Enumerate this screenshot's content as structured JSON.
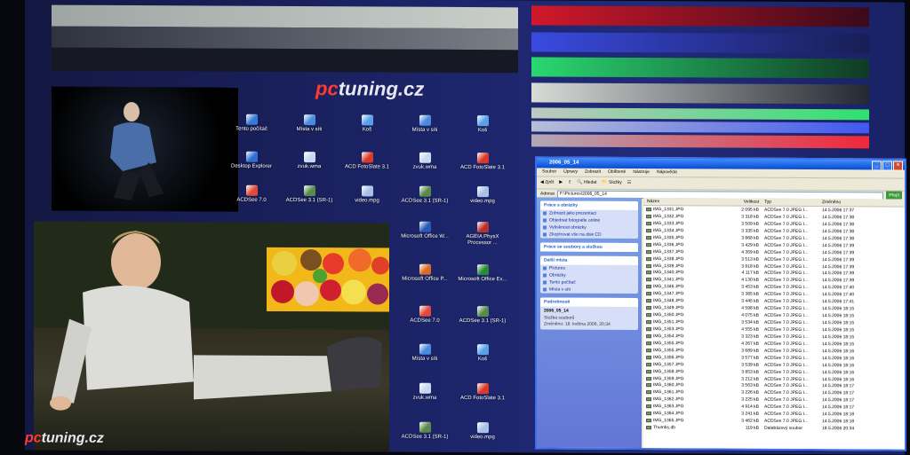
{
  "desktop": {
    "logo_top": {
      "pc": "pc",
      "rest": "tuning.cz"
    },
    "logo_bottom": {
      "pc": "pc",
      "rest": "tuning.cz"
    },
    "icons": [
      {
        "label": "Tento počítač",
        "color": "#3a78d8"
      },
      {
        "label": "Místa v síti",
        "color": "#4a8ae0"
      },
      {
        "label": "Koš",
        "color": "#5aa0e8"
      },
      {
        "label": "Místa v síti",
        "color": "#4a8ae0"
      },
      {
        "label": "Koš",
        "color": "#5aa0e8"
      },
      {
        "label": "Desktop Explorer",
        "color": "#2f6fd0"
      },
      {
        "label": "zvuk.wma",
        "color": "#c8d8f0"
      },
      {
        "label": "ACD FotoSlate 3.1",
        "color": "#d83a2a"
      },
      {
        "label": "zvuk.wma",
        "color": "#c8d8f0"
      },
      {
        "label": "ACD FotoSlate 3.1",
        "color": "#d83a2a"
      },
      {
        "label": "ACDSee 7.0",
        "color": "#e04a3a"
      },
      {
        "label": "ACDSee 3.1 (SR-1)",
        "color": "#5a8a4a"
      },
      {
        "label": "video.mpg",
        "color": "#a8c0e8"
      },
      {
        "label": "ACDSee 3.1 (SR-1)",
        "color": "#5a8a4a"
      },
      {
        "label": "video.mpg",
        "color": "#a8c0e8"
      },
      {
        "label": "Microsoft Office W...",
        "color": "#2a5ab8"
      },
      {
        "label": "AGEIA PhysX Processor ...",
        "color": "#b83030"
      },
      {
        "label": "Microsoft Office P...",
        "color": "#d86a2a"
      },
      {
        "label": "Microsoft Office Ex...",
        "color": "#2a8a3a"
      },
      {
        "label": "ACDSee 7.0",
        "color": "#e04a3a"
      },
      {
        "label": "ACDSee 3.1 (SR-1)",
        "color": "#5a8a4a"
      },
      {
        "label": "Místa v síti",
        "color": "#4a8ae0"
      },
      {
        "label": "Koš",
        "color": "#5aa0e8"
      },
      {
        "label": "zvuk.wma",
        "color": "#c8d8f0"
      },
      {
        "label": "ACD FotoSlate 3.1",
        "color": "#d83a2a"
      },
      {
        "label": "ACDSee 3.1 (SR-1)",
        "color": "#5a8a4a"
      },
      {
        "label": "video.mpg",
        "color": "#a8c0e8"
      }
    ]
  },
  "explorer": {
    "title": "2006_05_14",
    "menu": [
      "Soubor",
      "Úpravy",
      "Zobrazit",
      "Oblíbené",
      "Nástroje",
      "Nápověda"
    ],
    "toolbar": {
      "back": "Zpět",
      "search": "Hledat",
      "folders": "Složky"
    },
    "address_label": "Adresa",
    "address_value": "F:\\Pictures\\2006_05_14",
    "go": "Přejít",
    "panels": {
      "pictures": {
        "title": "Práce s obrázky",
        "items": [
          "Zobrazit jako prezentaci",
          "Objednat fotografie online",
          "Vytisknout obrázky",
          "Zkopírovat vše na disk CD"
        ]
      },
      "files": {
        "title": "Práce se soubory a složkou"
      },
      "places": {
        "title": "Další místa",
        "items": [
          "Pictures",
          "Obrázky",
          "Tento počítač",
          "Místa v síti"
        ]
      },
      "details": {
        "title": "Podrobnosti",
        "name": "2006_05_14",
        "type": "Složka souborů",
        "modified": "Změněno: 18. května 2006, 20:34"
      }
    },
    "columns": [
      "Název",
      "Velikost",
      "Typ",
      "Změněno"
    ],
    "files": [
      {
        "name": "IMG_1331.JPG",
        "size": "2 095 kB",
        "type": "ACDSee 7.0 JPEG I...",
        "date": "14.5.2006 17:37"
      },
      {
        "name": "IMG_1332.JPG",
        "size": "3 318 kB",
        "type": "ACDSee 7.0 JPEG I...",
        "date": "14.5.2006 17:38"
      },
      {
        "name": "IMG_1333.JPG",
        "size": "3 509 kB",
        "type": "ACDSee 7.0 JPEG I...",
        "date": "14.5.2006 17:38"
      },
      {
        "name": "IMG_1334.JPG",
        "size": "3 335 kB",
        "type": "ACDSee 7.0 JPEG I...",
        "date": "14.5.2006 17:38"
      },
      {
        "name": "IMG_1335.JPG",
        "size": "3 868 kB",
        "type": "ACDSee 7.0 JPEG I...",
        "date": "14.5.2006 17:38"
      },
      {
        "name": "IMG_1336.JPG",
        "size": "3 429 kB",
        "type": "ACDSee 7.0 JPEG I...",
        "date": "14.5.2006 17:39"
      },
      {
        "name": "IMG_1337.JPG",
        "size": "4 359 kB",
        "type": "ACDSee 7.0 JPEG I...",
        "date": "14.5.2006 17:39"
      },
      {
        "name": "IMG_1338.JPG",
        "size": "3 513 kB",
        "type": "ACDSee 7.0 JPEG I...",
        "date": "14.5.2006 17:39"
      },
      {
        "name": "IMG_1339.JPG",
        "size": "3 918 kB",
        "type": "ACDSee 7.0 JPEG I...",
        "date": "14.5.2006 17:39"
      },
      {
        "name": "IMG_1340.JPG",
        "size": "4 117 kB",
        "type": "ACDSee 7.0 JPEG I...",
        "date": "14.5.2006 17:39"
      },
      {
        "name": "IMG_1341.JPG",
        "size": "4 130 kB",
        "type": "ACDSee 7.0 JPEG I...",
        "date": "14.5.2006 17:39"
      },
      {
        "name": "IMG_1346.JPG",
        "size": "3 453 kB",
        "type": "ACDSee 7.0 JPEG I...",
        "date": "14.5.2006 17:40"
      },
      {
        "name": "IMG_1347.JPG",
        "size": "3 385 kB",
        "type": "ACDSee 7.0 JPEG I...",
        "date": "14.5.2006 17:40"
      },
      {
        "name": "IMG_1348.JPG",
        "size": "3 445 kB",
        "type": "ACDSee 7.0 JPEG I...",
        "date": "14.5.2006 17:41"
      },
      {
        "name": "IMG_1349.JPG",
        "size": "4 598 kB",
        "type": "ACDSee 7.0 JPEG I...",
        "date": "14.5.2006 18:15"
      },
      {
        "name": "IMG_1350.JPG",
        "size": "4 075 kB",
        "type": "ACDSee 7.0 JPEG I...",
        "date": "14.5.2006 18:15"
      },
      {
        "name": "IMG_1351.JPG",
        "size": "3 534 kB",
        "type": "ACDSee 7.0 JPEG I...",
        "date": "14.5.2006 18:15"
      },
      {
        "name": "IMG_1353.JPG",
        "size": "4 555 kB",
        "type": "ACDSee 7.0 JPEG I...",
        "date": "14.5.2006 18:15"
      },
      {
        "name": "IMG_1354.JPG",
        "size": "3 323 kB",
        "type": "ACDSee 7.0 JPEG I...",
        "date": "14.5.2006 18:15"
      },
      {
        "name": "IMG_1355.JPG",
        "size": "4 267 kB",
        "type": "ACDSee 7.0 JPEG I...",
        "date": "14.5.2006 18:15"
      },
      {
        "name": "IMG_1355.JPG",
        "size": "3 689 kB",
        "type": "ACDSee 7.0 JPEG I...",
        "date": "14.5.2006 18:16"
      },
      {
        "name": "IMG_1356.JPG",
        "size": "3 577 kB",
        "type": "ACDSee 7.0 JPEG I...",
        "date": "14.5.2006 18:16"
      },
      {
        "name": "IMG_1357.JPG",
        "size": "3 539 kB",
        "type": "ACDSee 7.0 JPEG I...",
        "date": "14.5.2006 18:16"
      },
      {
        "name": "IMG_1358.JPG",
        "size": "3 853 kB",
        "type": "ACDSee 7.0 JPEG I...",
        "date": "14.5.2006 18:16"
      },
      {
        "name": "IMG_1359.JPG",
        "size": "3 212 kB",
        "type": "ACDSee 7.0 JPEG I...",
        "date": "14.5.2006 18:16"
      },
      {
        "name": "IMG_1360.JPG",
        "size": "3 563 kB",
        "type": "ACDSee 7.0 JPEG I...",
        "date": "14.5.2006 18:17"
      },
      {
        "name": "IMG_1361.JPG",
        "size": "3 226 kB",
        "type": "ACDSee 7.0 JPEG I...",
        "date": "14.5.2006 18:17"
      },
      {
        "name": "IMG_1362.JPG",
        "size": "3 225 kB",
        "type": "ACDSee 7.0 JPEG I...",
        "date": "14.5.2006 18:17"
      },
      {
        "name": "IMG_1363.JPG",
        "size": "4 914 kB",
        "type": "ACDSee 7.0 JPEG I...",
        "date": "14.5.2006 18:17"
      },
      {
        "name": "IMG_1364.JPG",
        "size": "3 241 kB",
        "type": "ACDSee 7.0 JPEG I...",
        "date": "14.5.2006 18:18"
      },
      {
        "name": "IMG_1365.JPG",
        "size": "3 462 kB",
        "type": "ACDSee 7.0 JPEG I...",
        "date": "14.5.2006 18:18"
      },
      {
        "name": "Thumbs.db",
        "size": "119 kB",
        "type": "Databázový soubor",
        "date": "18.5.2006 20:34"
      }
    ]
  }
}
